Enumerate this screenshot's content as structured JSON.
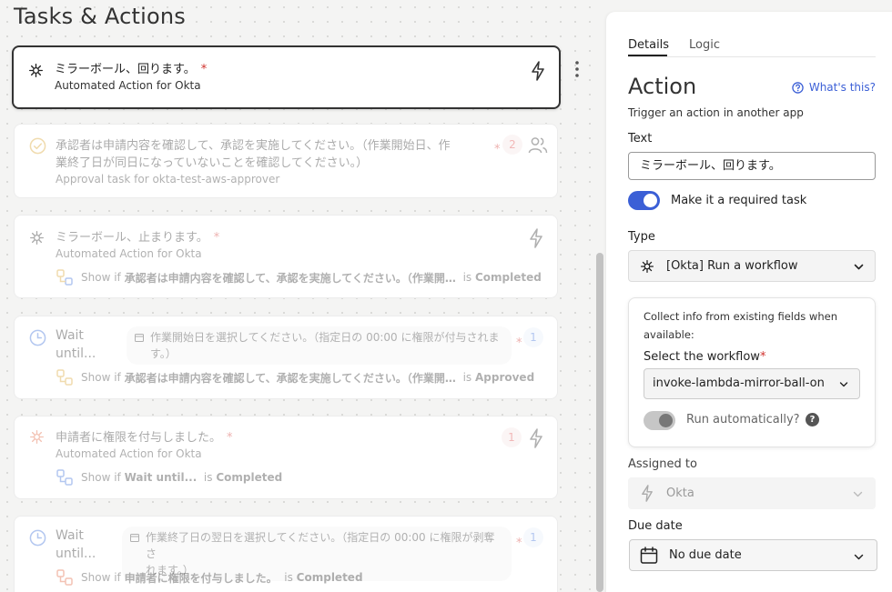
{
  "page": {
    "title": "Tasks & Actions"
  },
  "cards": [
    {
      "title": "ミラーボール、回ります。",
      "required": "*",
      "subtitle": "Automated Action for Okta"
    },
    {
      "title_line1": "承認者は申請内容を確認して、承認を実施してください。（作業開始日、作",
      "title_line2": "業終了日が同日になっていないことを確認してください。）",
      "required": "*",
      "count": "2",
      "subtitle": "Approval task for okta-test-aws-approver"
    },
    {
      "title": "ミラーボール、止まります。",
      "required": "*",
      "subtitle": "Automated Action for Okta",
      "condition": {
        "prefix": "Show if",
        "ref": "承認者は申請内容を確認して、承認を実施してください。（作業開…",
        "op": "is",
        "value": "Completed"
      }
    },
    {
      "title_line1": "Wait",
      "title_line2": "until...",
      "field_line1": "作業開始日を選択してください。（指定日の 00:00 に権限が付与されま",
      "field_line2": "す。）",
      "required": "*",
      "count": "1",
      "condition": {
        "prefix": "Show if",
        "ref": "承認者は申請内容を確認して、承認を実施してください。（作業開…",
        "op": "is",
        "value": "Approved"
      }
    },
    {
      "title": "申請者に権限を付与しました。",
      "required": "*",
      "count": "1",
      "subtitle": "Automated Action for Okta",
      "condition": {
        "prefix": "Show if",
        "ref": "Wait until...",
        "op": "is",
        "value": "Completed"
      }
    },
    {
      "title_line1": "Wait",
      "title_line2": "until...",
      "field_line1": "作業終了日の翌日を選択してください。（指定日の 00:00 に権限が剥奪さ",
      "field_line2": "れます。）",
      "required": "*",
      "count": "1",
      "condition": {
        "prefix": "Show if",
        "ref": "申請者に権限を付与しました。",
        "op": "is",
        "value": "Completed"
      }
    }
  ],
  "panel": {
    "tabs": [
      "Details",
      "Logic"
    ],
    "heading": "Action",
    "whats_this": "What's this?",
    "description": "Trigger an action in another app",
    "text_label": "Text",
    "text_value": "ミラーボール、回ります。",
    "required_toggle_label": "Make it a required task",
    "type_label": "Type",
    "type_value": "[Okta] Run a workflow",
    "collect_text": "Collect info from existing fields when available:",
    "workflow_label": "Select the workflow",
    "workflow_required": "*",
    "workflow_value": "invoke-lambda-mirror-ball-on",
    "run_auto_label": "Run automatically?",
    "help_glyph": "?",
    "assigned_label": "Assigned to",
    "assigned_value": "Okta",
    "due_label": "Due date",
    "due_value": "No due date"
  },
  "colors": {
    "accent": "#3b5fd6",
    "required": "#d0312d",
    "approval": "#d9a22c",
    "okta_spark": "#e0603a",
    "wait_clock": "#3b6fd8"
  }
}
